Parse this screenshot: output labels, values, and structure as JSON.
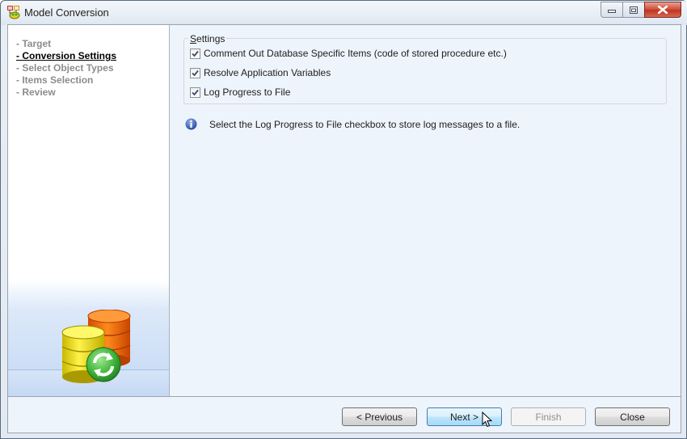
{
  "window": {
    "title": "Model Conversion",
    "icon": "model-conversion-app-icon",
    "controls": [
      "minimize",
      "maximize",
      "close"
    ]
  },
  "wizard_steps": [
    {
      "label": "- Target",
      "active": false
    },
    {
      "label": "- Conversion Settings",
      "active": true
    },
    {
      "label": "- Select Object Types",
      "active": false
    },
    {
      "label": "- Items Selection",
      "active": false
    },
    {
      "label": "- Review",
      "active": false
    }
  ],
  "settings": {
    "group_title_mnemonic": "S",
    "group_title_rest": "ettings",
    "options": [
      {
        "label": "Comment Out Database Specific Items (code of stored procedure etc.)",
        "checked": true
      },
      {
        "label": "Resolve Application Variables",
        "checked": true
      },
      {
        "label": "Log Progress to File",
        "checked": true
      }
    ]
  },
  "info": {
    "icon": "info-icon",
    "text": "Select the Log Progress to File checkbox to store log messages to a file."
  },
  "buttons": {
    "previous": "< Previous",
    "next": "Next >",
    "finish": "Finish",
    "close": "Close"
  },
  "colors": {
    "accent_focus": "#3c7fb1",
    "close_button": "#c2341f",
    "panel_background": "#eef4fb"
  }
}
